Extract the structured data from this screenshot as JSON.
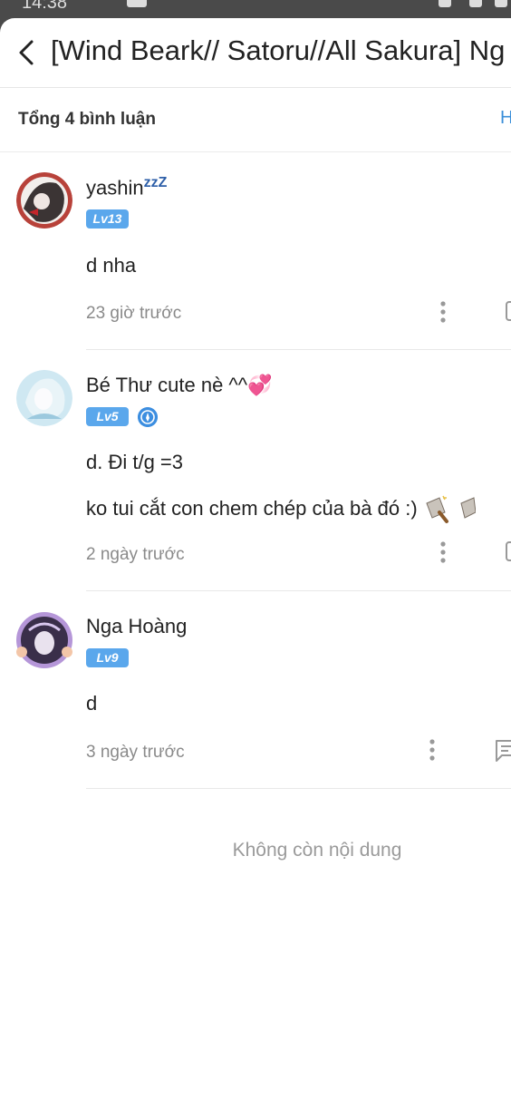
{
  "statusbar": {
    "time": "14:38"
  },
  "header": {
    "title": "[Wind Beark// Satoru//All Sakura] Ng",
    "sort_label": "H"
  },
  "summary": {
    "count_text": "Tổng 4 bình luận"
  },
  "comments": [
    {
      "user": "yashin",
      "user_suffix": "zzZ",
      "level": "Lv13",
      "lines": [
        "d nha"
      ],
      "time": "23 giờ trước"
    },
    {
      "user": "Bé Thư cute nè ^^",
      "user_suffix": "💞",
      "level": "Lv5",
      "lines": [
        "d.  Đi t/g =3",
        "ko tui cắt con chem chép của bà đó :)"
      ],
      "time": "2 ngày trước"
    },
    {
      "user": "Nga Hoàng",
      "user_suffix": "",
      "level": "Lv9",
      "lines": [
        "d"
      ],
      "time": "3 ngày trước"
    }
  ],
  "footer": {
    "end_text": "Không còn nội dung"
  },
  "colors": {
    "accent": "#3b8fd9",
    "level_badge": "#5aa7ec",
    "muted_text": "#8a8a8a"
  }
}
